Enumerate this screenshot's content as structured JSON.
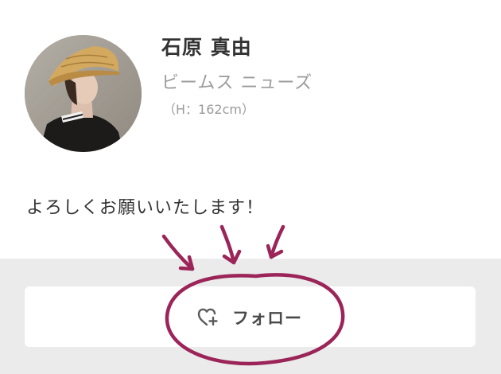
{
  "profile": {
    "name": "石原 真由",
    "shop": "ビームス ニューズ",
    "height": "（H：162cm）",
    "bio": "よろしくお願いいたします！"
  },
  "follow": {
    "label": "フォロー",
    "icon": "heart-plus-icon"
  },
  "annotation": {
    "color": "#9b2458",
    "marks": [
      "arrow",
      "arrow",
      "arrow",
      "circle"
    ]
  }
}
